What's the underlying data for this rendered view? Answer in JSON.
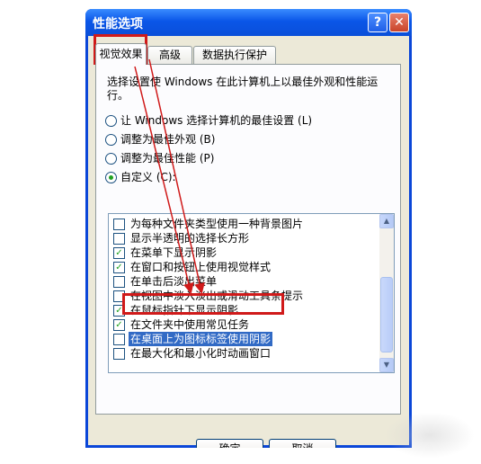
{
  "window": {
    "title": "性能选项",
    "help_glyph": "?",
    "close_glyph": "✕"
  },
  "tabs": [
    {
      "label": "视觉效果",
      "active": true
    },
    {
      "label": "高级",
      "active": false
    },
    {
      "label": "数据执行保护",
      "active": false
    }
  ],
  "panel": {
    "description": "选择设置使 Windows 在此计算机上以最佳外观和性能运行。",
    "radios": [
      {
        "label": "让 Windows 选择计算机的最佳设置 (L)",
        "checked": false
      },
      {
        "label": "调整为最佳外观 (B)",
        "checked": false
      },
      {
        "label": "调整为最佳性能 (P)",
        "checked": false
      },
      {
        "label": "自定义 (C):",
        "checked": true
      }
    ],
    "options": [
      {
        "label": "为每种文件夹类型使用一种背景图片",
        "checked": false
      },
      {
        "label": "显示半透明的选择长方形",
        "checked": false
      },
      {
        "label": "在菜单下显示阴影",
        "checked": true
      },
      {
        "label": "在窗口和按钮上使用视觉样式",
        "checked": true
      },
      {
        "label": "在单击后淡出菜单",
        "checked": false
      },
      {
        "label": "在视图中淡入淡出或滑动工具条提示",
        "checked": false
      },
      {
        "label": "在鼠标指针下显示阴影",
        "checked": true
      },
      {
        "label": "在文件夹中使用常见任务",
        "checked": true
      },
      {
        "label": "在桌面上为图标标签使用阴影",
        "checked": false,
        "selected": true
      },
      {
        "label": "在最大化和最小化时动画窗口",
        "checked": false
      }
    ],
    "scroll_up_glyph": "▲",
    "scroll_down_glyph": "▼",
    "check_glyph": "✓"
  },
  "buttons": {
    "ok": "确定",
    "cancel": "取消"
  },
  "colors": {
    "titlebar": "#0a56e8",
    "selection": "#316ac5",
    "annotation": "#d01a1a",
    "check": "#21a121"
  }
}
